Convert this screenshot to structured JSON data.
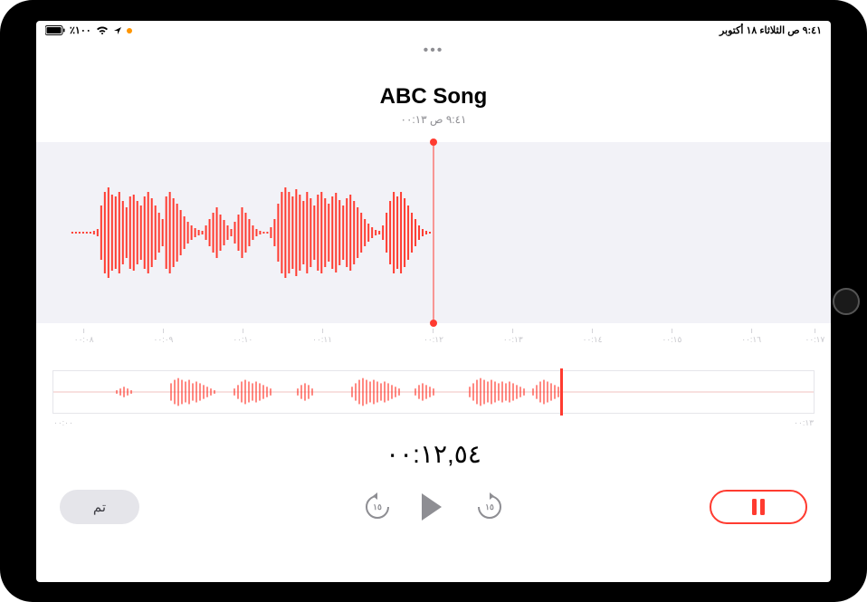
{
  "status_bar": {
    "right_text": "٩:٤١ ص الثلاثاء ١٨ أكتوبر",
    "left_battery_pct": "٪١٠٠"
  },
  "header": {
    "title": "ABC Song",
    "subtitle": "٩:٤١ ص   ٠٠:١٣"
  },
  "timeline": {
    "ticks": [
      "٠٠:٠٨",
      "٠٠:٠٩",
      "٠٠:١٠",
      "٠٠:١١",
      "٠٠:١٢",
      "٠٠:١٣",
      "٠٠:١٤",
      "٠٠:١٥",
      "٠٠:١٦",
      "٠٠:١٧"
    ]
  },
  "overview": {
    "start": "٠٠:٠٠",
    "end": "٠٠:١٣"
  },
  "current_time": "٠٠:١٢,٥٤",
  "controls": {
    "done_label": "تم",
    "skip_back_seconds": "١٥",
    "skip_fwd_seconds": "١٥"
  },
  "colors": {
    "accent": "#ff3b30",
    "gray_bg": "#f2f2f7",
    "mute": "#8e8e93"
  }
}
